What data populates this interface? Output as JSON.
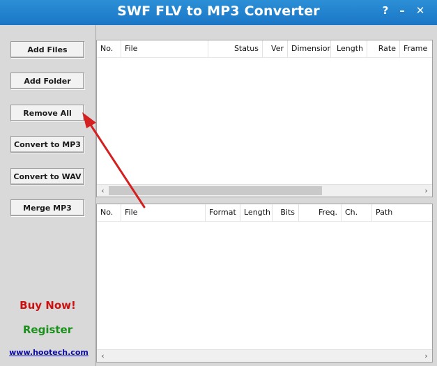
{
  "window": {
    "title": "SWF FLV to MP3 Converter",
    "help": "?",
    "minimize": "–",
    "close": "✕"
  },
  "sidebar": {
    "add_files": "Add Files",
    "add_folder": "Add Folder",
    "remove_all": "Remove All",
    "convert_mp3": "Convert to MP3",
    "convert_wav": "Convert to WAV",
    "merge_mp3": "Merge MP3",
    "buy_now": "Buy Now!",
    "register": "Register",
    "website": "www.hootech.com"
  },
  "input_list": {
    "columns": [
      "No.",
      "File",
      "Status",
      "Ver",
      "Dimension",
      "Length",
      "Rate",
      "Frame"
    ],
    "rows": [],
    "scroll_left": "‹",
    "scroll_right": "›"
  },
  "output_list": {
    "columns": [
      "No.",
      "File",
      "Format",
      "Length",
      "Bits",
      "Freq.",
      "Ch.",
      "Path"
    ],
    "rows": [],
    "scroll_left": "‹",
    "scroll_right": "›"
  },
  "colors": {
    "titlebar": "#1f7fcc",
    "annotation_arrow": "#d42020",
    "buy_now": "#cc1010",
    "register": "#1b8f1b",
    "link": "#0a0aa8"
  },
  "icons": {
    "annotation": "red-arrow-icon"
  }
}
